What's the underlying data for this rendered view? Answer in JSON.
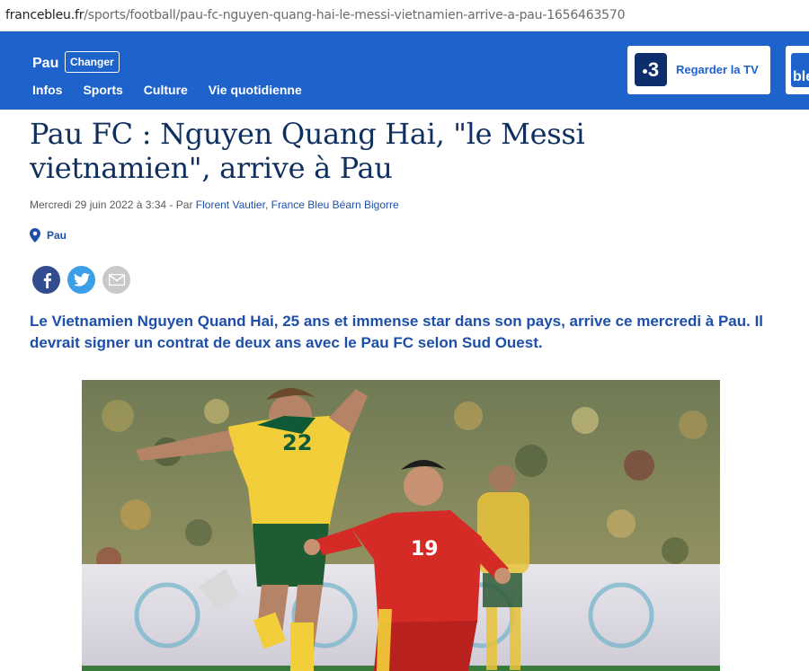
{
  "browser": {
    "url_domain": "francebleu.fr",
    "url_path": "/sports/football/pau-fc-nguyen-quang-hai-le-messi-vietnamien-arrive-a-pau-1656463570"
  },
  "header": {
    "city": "Pau",
    "changer_label": "Changer",
    "nav": [
      "Infos",
      "Sports",
      "Culture",
      "Vie quotidienne"
    ],
    "tv_button_label": "Regarder la TV",
    "tv_logo_text": "3",
    "bleu_logo_text": "ble",
    "brand_color": "#1e63cc"
  },
  "article": {
    "title": "Pau FC : Nguyen Quang Hai, \"le Messi vietnamien\", arrive à Pau",
    "meta_prefix": "Mercredi 29 juin 2022 à 3:34 - Par ",
    "author": "Florent Vautier",
    "separator": ", ",
    "station": "France Bleu Béarn Bigorre",
    "location": "Pau",
    "lead": "Le Vietnamien Nguyen Quand Hai, 25 ans et immense star dans son pays, arrive ce mercredi à Pau. Il devrait signer un contrat de deux ans avec le Pau FC selon Sud Ouest.",
    "photo": {
      "jersey_number_yellow": "22",
      "jersey_number_red": "19"
    }
  },
  "share": {
    "icons": [
      "facebook-icon",
      "twitter-icon",
      "email-icon"
    ]
  }
}
